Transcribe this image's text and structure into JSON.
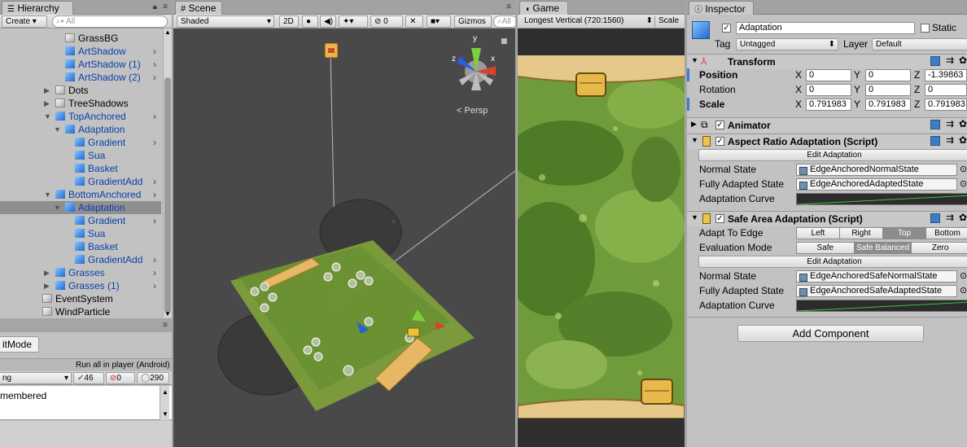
{
  "hierarchy": {
    "tab_title": "Hierarchy",
    "create_label": "Create",
    "search_placeholder": "All",
    "items": [
      {
        "label": "GrassBG",
        "color": "#000000"
      },
      {
        "label": "ArtShadow",
        "color": "#0b3fa8"
      },
      {
        "label": "ArtShadow (1)",
        "color": "#0b3fa8"
      },
      {
        "label": "ArtShadow (2)",
        "color": "#0b3fa8"
      },
      {
        "label": "Dots",
        "color": "#000000"
      },
      {
        "label": "TreeShadows",
        "color": "#000000"
      },
      {
        "label": "TopAnchored",
        "color": "#0b3fa8"
      },
      {
        "label": "Adaptation",
        "color": "#0b3fa8"
      },
      {
        "label": "Gradient",
        "color": "#0b3fa8"
      },
      {
        "label": "Sua",
        "color": "#0b3fa8"
      },
      {
        "label": "Basket",
        "color": "#0b3fa8"
      },
      {
        "label": "GradientAdd",
        "color": "#0b3fa8"
      },
      {
        "label": "BottomAnchored",
        "color": "#0b3fa8"
      },
      {
        "label": "Adaptation",
        "color": "#0b3fa8"
      },
      {
        "label": "Gradient",
        "color": "#0b3fa8"
      },
      {
        "label": "Sua",
        "color": "#0b3fa8"
      },
      {
        "label": "Basket",
        "color": "#0b3fa8"
      },
      {
        "label": "GradientAdd",
        "color": "#0b3fa8"
      },
      {
        "label": "Grasses",
        "color": "#0b3fa8"
      },
      {
        "label": "Grasses (1)",
        "color": "#0b3fa8"
      },
      {
        "label": "EventSystem",
        "color": "#000000"
      },
      {
        "label": "WindParticle",
        "color": "#000000"
      }
    ]
  },
  "test_runner": {
    "editmode_tab": "itMode",
    "run_all_label": "Run all in player (Android)",
    "dropdown_value": "ng",
    "passed_count": "46",
    "failed_count": "0",
    "skipped_count": "290",
    "log_text": "membered"
  },
  "scene": {
    "tab_title": "Scene",
    "shading_mode": "Shaded",
    "mode_2d": "2D",
    "hidden_count": "0",
    "gizmos_label": "Gizmos",
    "search_placeholder": "All",
    "persp_label": "Persp",
    "axis_x": "x",
    "axis_y": "y",
    "axis_z": "z"
  },
  "game": {
    "tab_title": "Game",
    "resolution": "Longest Vertical (720:1560)",
    "scale_label": "Scale"
  },
  "inspector": {
    "tab_title": "Inspector",
    "object_name": "Adaptation",
    "static_label": "Static",
    "tag_label": "Tag",
    "tag_value": "Untagged",
    "layer_label": "Layer",
    "layer_value": "Default",
    "transform": {
      "title": "Transform",
      "position_label": "Position",
      "rotation_label": "Rotation",
      "scale_label": "Scale",
      "position": {
        "x": "0",
        "y": "0",
        "z": "-1.39863"
      },
      "rotation": {
        "x": "0",
        "y": "0",
        "z": "0"
      },
      "scale": {
        "x": "0.791983",
        "y": "0.791983",
        "z": "0.791983"
      }
    },
    "animator_title": "Animator",
    "aspect": {
      "title": "Aspect Ratio Adaptation (Script)",
      "edit_button": "Edit Adaptation",
      "normal_state_label": "Normal State",
      "normal_state_value": "EdgeAnchoredNormalState",
      "adapted_state_label": "Fully Adapted State",
      "adapted_state_value": "EdgeAnchoredAdaptedState",
      "curve_label": "Adaptation Curve"
    },
    "safe": {
      "title": "Safe Area Adaptation (Script)",
      "edge_label": "Adapt To Edge",
      "edges": [
        "Left",
        "Right",
        "Top",
        "Bottom"
      ],
      "edge_selected": "Top",
      "mode_label": "Evaluation Mode",
      "modes": [
        "Safe",
        "Safe Balanced",
        "Zero"
      ],
      "mode_selected": "Safe Balanced",
      "edit_button": "Edit Adaptation",
      "normal_state_label": "Normal State",
      "normal_state_value": "EdgeAnchoredSafeNormalState",
      "adapted_state_label": "Fully Adapted State",
      "adapted_state_value": "EdgeAnchoredSafeAdaptedState",
      "curve_label": "Adaptation Curve"
    },
    "add_component": "Add Component"
  },
  "colors": {
    "accent_blue": "#0b3fa8",
    "scene_bg": "#4a4a4a",
    "grass_green": "#6f9b3a"
  }
}
